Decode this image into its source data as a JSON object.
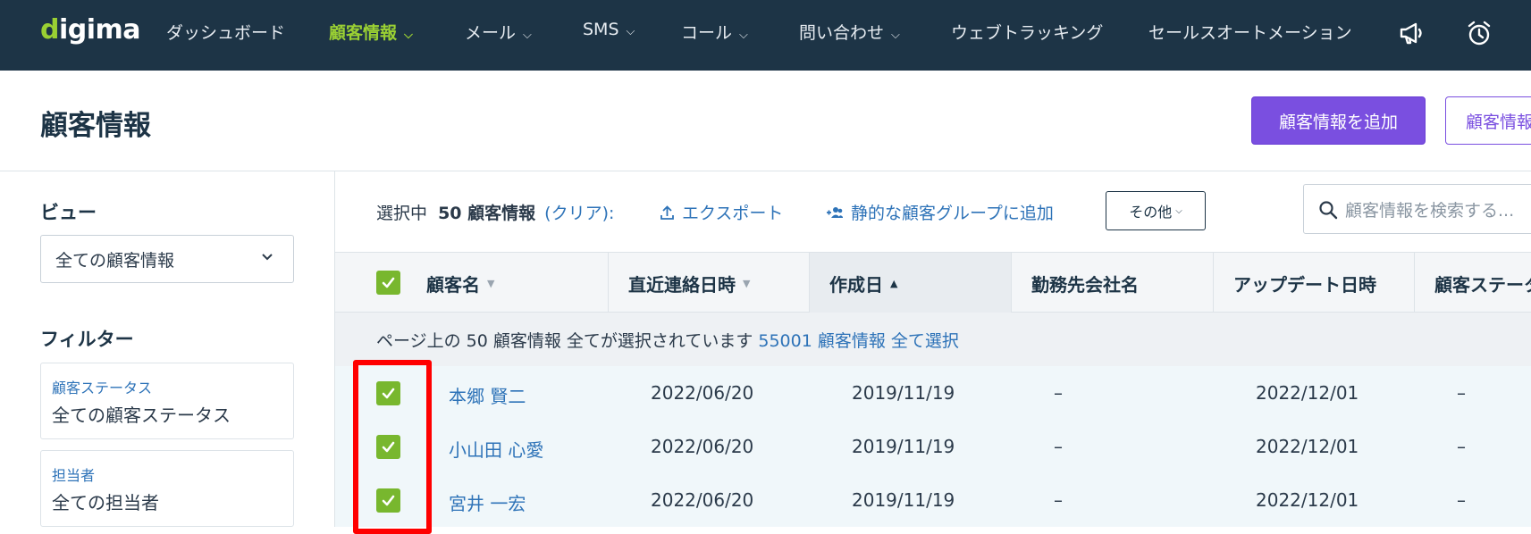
{
  "nav": {
    "logo": "digima",
    "items": [
      {
        "label": "ダッシュボード",
        "dropdown": false,
        "active": false
      },
      {
        "label": "顧客情報",
        "dropdown": true,
        "active": true
      },
      {
        "label": "メール",
        "dropdown": true,
        "active": false
      },
      {
        "label": "SMS",
        "dropdown": true,
        "active": false
      },
      {
        "label": "コール",
        "dropdown": true,
        "active": false
      },
      {
        "label": "問い合わせ",
        "dropdown": true,
        "active": false
      },
      {
        "label": "ウェブトラッキング",
        "dropdown": false,
        "active": false
      },
      {
        "label": "セールスオートメーション",
        "dropdown": false,
        "active": false
      }
    ],
    "icons": [
      "megaphone-icon",
      "alarm-clock-icon"
    ]
  },
  "header": {
    "title": "顧客情報",
    "add_button": "顧客情報を追加",
    "second_button": "顧客情報"
  },
  "sidebar": {
    "view_heading": "ビュー",
    "view_value": "全ての顧客情報",
    "filter_heading": "フィルター",
    "filters": [
      {
        "label": "顧客ステータス",
        "value": "全ての顧客ステータス"
      },
      {
        "label": "担当者",
        "value": "全ての担当者"
      }
    ]
  },
  "toolbar": {
    "selected_prefix": "選択中",
    "selected_count": "50 顧客情報",
    "clear_open": "(",
    "clear_label": "クリア",
    "clear_close": "):",
    "export_label": "エクスポート",
    "add_group_label": "静的な顧客グループに追加",
    "more_label": "その他",
    "search_placeholder": "顧客情報を検索する..."
  },
  "table": {
    "columns": [
      "顧客名",
      "直近連絡日時",
      "作成日",
      "勤務先会社名",
      "アップデート日時",
      "顧客ステータス"
    ],
    "sorted_column": "作成日",
    "banner_text": "ページ上の 50 顧客情報 全てが選択されています",
    "banner_link": "55001 顧客情報 全て選択",
    "rows": [
      {
        "name": "本郷 賢二",
        "last_contact": "2022/06/20",
        "created": "2019/11/19",
        "company": "–",
        "updated": "2022/12/01",
        "status": "–"
      },
      {
        "name": "小山田 心愛",
        "last_contact": "2022/06/20",
        "created": "2019/11/19",
        "company": "–",
        "updated": "2022/12/01",
        "status": "–"
      },
      {
        "name": "宮井 一宏",
        "last_contact": "2022/06/20",
        "created": "2019/11/19",
        "company": "–",
        "updated": "2022/12/01",
        "status": "–"
      }
    ]
  },
  "colors": {
    "nav_bg": "#1d3446",
    "accent_green": "#9ad033",
    "checkbox_green": "#78b72e",
    "primary_purple": "#7a4fe0",
    "link_blue": "#2e73b8",
    "highlight_red": "#ff0000"
  }
}
